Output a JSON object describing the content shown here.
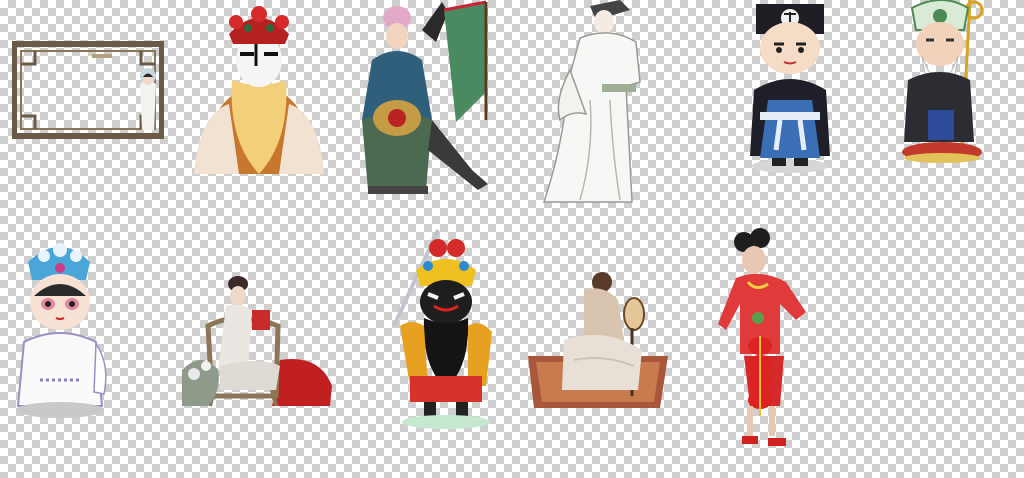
{
  "canvas": {
    "background": "transparency-checkerboard",
    "checker_color": "#cfcfcf"
  },
  "figures": [
    {
      "name": "ornate-frame-lady",
      "icon": "lattice-frame-icon"
    },
    {
      "name": "opera-bearded-king",
      "icon": "opera-mask-icon"
    },
    {
      "name": "opera-general-flags",
      "icon": "opera-general-icon"
    },
    {
      "name": "scholar-white-robe",
      "icon": "scholar-icon"
    },
    {
      "name": "cartoon-official-blue",
      "icon": "cartoon-official-icon"
    },
    {
      "name": "cartoon-old-man-staff",
      "icon": "cartoon-elder-icon"
    },
    {
      "name": "cartoon-opera-lady",
      "icon": "cartoon-lady-icon"
    },
    {
      "name": "lady-on-chair",
      "icon": "seated-lady-icon"
    },
    {
      "name": "cartoon-opera-warrior-sword",
      "icon": "cartoon-warrior-icon"
    },
    {
      "name": "lady-kneeling-fan",
      "icon": "kneeling-lady-icon"
    },
    {
      "name": "girl-red-costume-lanterns",
      "icon": "dancing-girl-icon"
    }
  ]
}
